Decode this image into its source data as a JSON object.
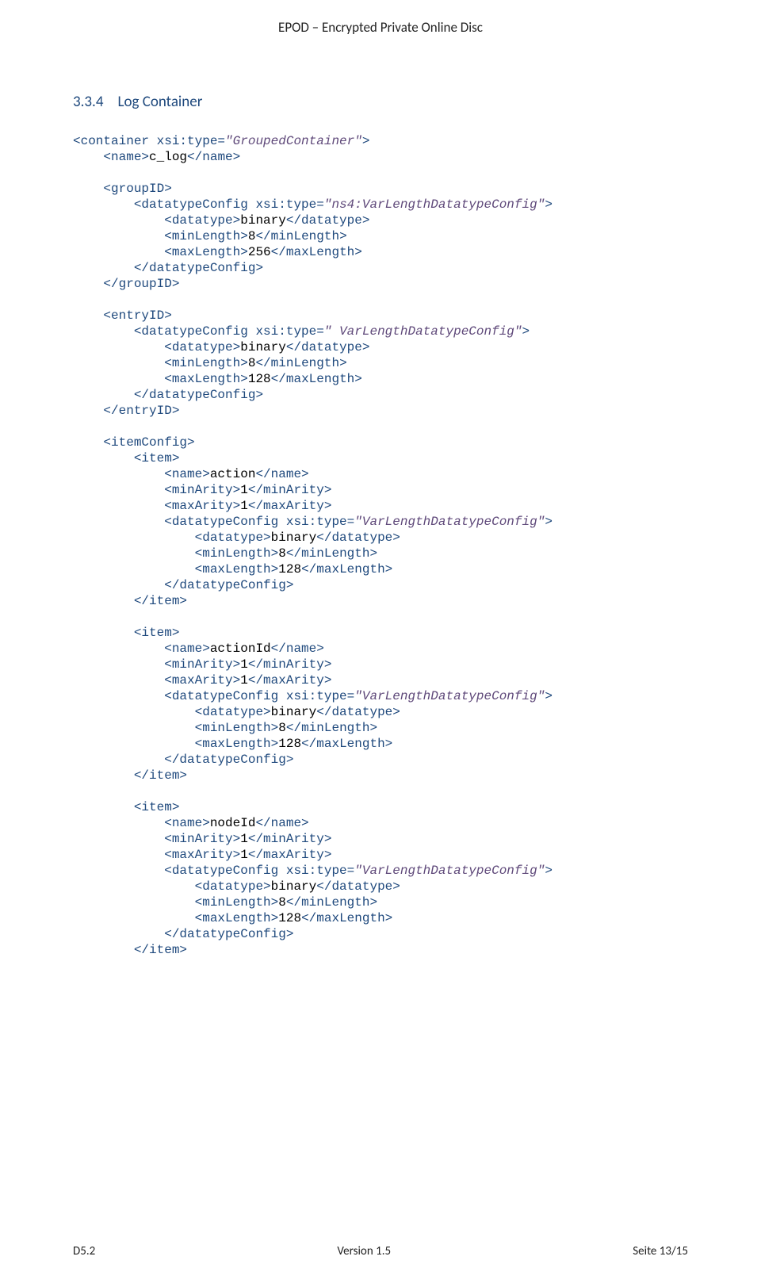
{
  "header": {
    "title": "EPOD – Encrypted Private Online Disc"
  },
  "section": {
    "number": "3.3.4",
    "title": "Log Container"
  },
  "code": {
    "container_type": "\"GroupedContainer\"",
    "name_val": "c_log",
    "groupid_type": "\"ns4:VarLengthDatatypeConfig\"",
    "entryid_type": "\" VarLengthDatatypeConfig\"",
    "item_type": "\"VarLengthDatatypeConfig\"",
    "datatype_val": "binary",
    "minlen_8": "8",
    "maxlen_256": "256",
    "maxlen_128": "128",
    "minarity_1": "1",
    "maxarity_1": "1",
    "item1_name": "action",
    "item2_name": "actionId",
    "item3_name": "nodeId"
  },
  "footer": {
    "left": "D5.2",
    "center": "Version 1.5",
    "right": "Seite 13/15"
  }
}
